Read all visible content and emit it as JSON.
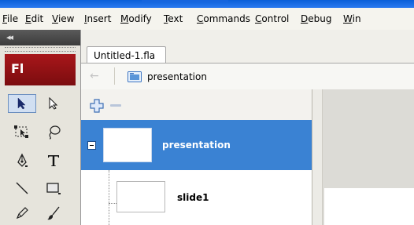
{
  "menu": [
    "File",
    "Edit",
    "View",
    "Insert",
    "Modify",
    "Text",
    "Commands",
    "Control",
    "Debug",
    "Win"
  ],
  "tools": {
    "logo": "Fl",
    "collapse_icon": "◂◂"
  },
  "document": {
    "tab_label": "Untitled-1.fla",
    "breadcrumb": "presentation"
  },
  "outline": {
    "items": [
      {
        "label": "presentation",
        "selected": true,
        "expanded": true
      },
      {
        "label": "slide1",
        "selected": false
      }
    ]
  },
  "colors": {
    "selection": "#3a82d3",
    "logo_red": "#a8171a",
    "title_blue": "#0a5fd8"
  }
}
